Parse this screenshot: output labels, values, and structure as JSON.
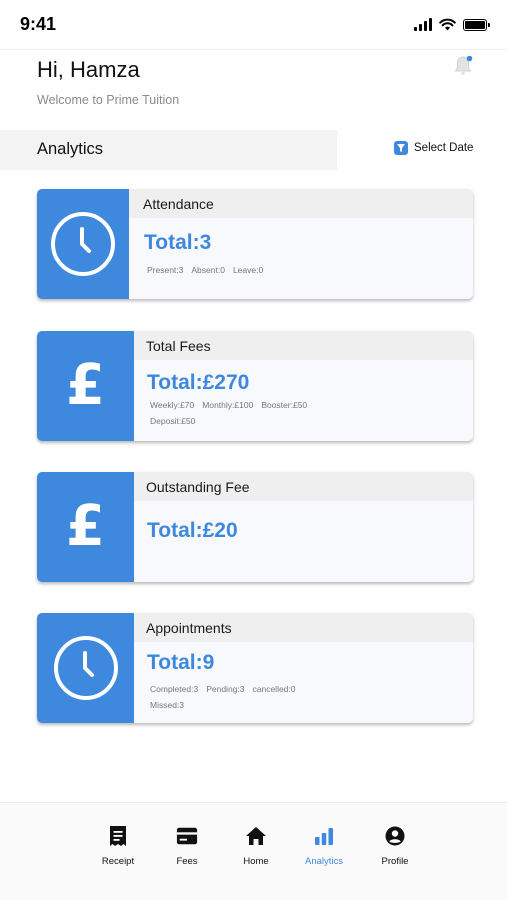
{
  "status_bar": {
    "time": "9:41"
  },
  "header": {
    "greeting": "Hi, Hamza",
    "welcome": "Welcome to Prime Tuition",
    "notification_dot_color": "#3e88dd"
  },
  "analytics": {
    "title": "Analytics",
    "select_date_label": "Select Date"
  },
  "cards": [
    {
      "title": "Attendance",
      "total": "Total:3",
      "icon": "clock-icon",
      "details": [
        "Present:3",
        "Absent:0",
        "Leave:0"
      ]
    },
    {
      "title": "Total Fees",
      "total": "Total:£270",
      "icon": "pound-icon",
      "details": [
        "Weekly:£70",
        "Monthly:£100",
        "Booster:£50",
        "Deposit:£50"
      ]
    },
    {
      "title": "Outstanding Fee",
      "total": "Total:£20",
      "icon": "pound-icon",
      "details": []
    },
    {
      "title": "Appointments",
      "total": "Total:9",
      "icon": "clock-icon",
      "details": [
        "Completed:3",
        "Pending:3",
        "cancelled:0",
        "Missed:3"
      ]
    }
  ],
  "bottom_nav": {
    "items": [
      {
        "label": "Receipt",
        "icon": "receipt-icon",
        "active": false
      },
      {
        "label": "Fees",
        "icon": "card-icon",
        "active": false
      },
      {
        "label": "Home",
        "icon": "home-icon",
        "active": false
      },
      {
        "label": "Analytics",
        "icon": "bar-chart-icon",
        "active": true
      },
      {
        "label": "Profile",
        "icon": "profile-icon",
        "active": false
      }
    ]
  },
  "colors": {
    "accent": "#3e88dd",
    "card_header": "#efefef",
    "card_body": "#f7f9fc"
  }
}
